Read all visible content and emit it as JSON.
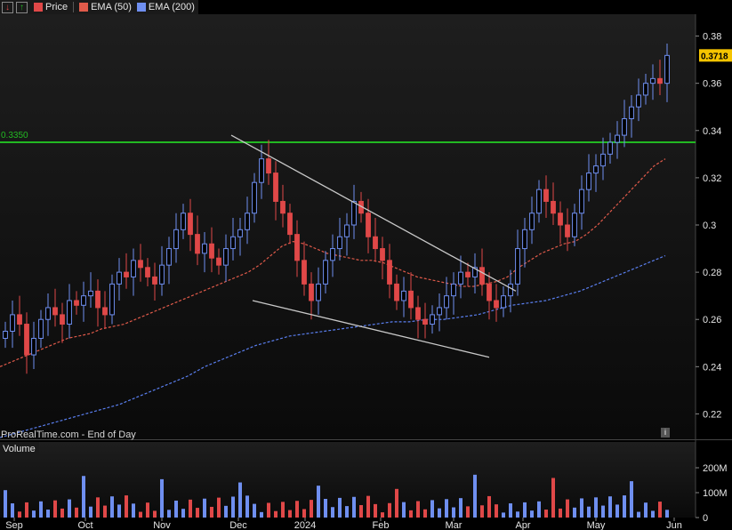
{
  "legend": {
    "price": "Price",
    "ema50": "EMA (50)",
    "ema200": "EMA (200)",
    "volume": "Volume",
    "colors": {
      "up": "#6f8ff0",
      "down": "#e04848",
      "ema50": "#e05a4a",
      "ema200": "#5a7ff0",
      "level": "#22b822"
    }
  },
  "watermark": "ProRealTime.com - End of Day",
  "info_icon": "i",
  "level_line": {
    "label": "0.3350",
    "value": 0.335
  },
  "last_price": "0.3718",
  "y_ticks": [
    "0.38",
    "0.36",
    "0.34",
    "0.32",
    "0.3",
    "0.28",
    "0.26",
    "0.24",
    "0.22"
  ],
  "volume_ticks": [
    "200M",
    "100M",
    "0"
  ],
  "x_ticks": [
    "Sep",
    "Oct",
    "Nov",
    "Dec",
    "2024",
    "Feb",
    "Mar",
    "Apr",
    "May",
    "Jun"
  ],
  "chart_data": {
    "type": "candlestick",
    "x_labels": [
      "Sep",
      "Oct",
      "Nov",
      "Dec",
      "2024",
      "Feb",
      "Mar",
      "Apr",
      "May",
      "Jun"
    ],
    "y_range": [
      0.21,
      0.39
    ],
    "volume_range_M": [
      0,
      250
    ],
    "horizontal_level": 0.335,
    "last_price": 0.3718,
    "close_series": [
      0.255,
      0.262,
      0.258,
      0.245,
      0.252,
      0.26,
      0.265,
      0.262,
      0.258,
      0.268,
      0.266,
      0.27,
      0.272,
      0.265,
      0.262,
      0.275,
      0.28,
      0.278,
      0.285,
      0.282,
      0.278,
      0.275,
      0.283,
      0.29,
      0.298,
      0.305,
      0.296,
      0.288,
      0.292,
      0.286,
      0.283,
      0.29,
      0.295,
      0.298,
      0.305,
      0.318,
      0.328,
      0.322,
      0.31,
      0.305,
      0.296,
      0.285,
      0.275,
      0.268,
      0.275,
      0.285,
      0.29,
      0.295,
      0.3,
      0.31,
      0.305,
      0.295,
      0.29,
      0.285,
      0.275,
      0.268,
      0.272,
      0.265,
      0.26,
      0.258,
      0.262,
      0.265,
      0.27,
      0.275,
      0.28,
      0.278,
      0.282,
      0.275,
      0.268,
      0.265,
      0.27,
      0.275,
      0.29,
      0.298,
      0.305,
      0.315,
      0.31,
      0.305,
      0.3,
      0.295,
      0.305,
      0.315,
      0.322,
      0.325,
      0.33,
      0.335,
      0.338,
      0.345,
      0.35,
      0.355,
      0.36,
      0.362,
      0.36,
      0.3718
    ],
    "ema50_series": [
      0.24,
      0.242,
      0.244,
      0.246,
      0.248,
      0.25,
      0.252,
      0.253,
      0.254,
      0.256,
      0.257,
      0.258,
      0.26,
      0.262,
      0.264,
      0.266,
      0.268,
      0.27,
      0.272,
      0.274,
      0.276,
      0.278,
      0.28,
      0.283,
      0.287,
      0.291,
      0.293,
      0.292,
      0.29,
      0.288,
      0.287,
      0.286,
      0.285,
      0.285,
      0.284,
      0.282,
      0.28,
      0.278,
      0.277,
      0.276,
      0.275,
      0.274,
      0.274,
      0.275,
      0.276,
      0.278,
      0.282,
      0.285,
      0.288,
      0.29,
      0.292,
      0.293,
      0.296,
      0.3,
      0.305,
      0.31,
      0.315,
      0.32,
      0.325,
      0.328
    ],
    "ema200_series": [
      0.21,
      0.212,
      0.214,
      0.216,
      0.218,
      0.22,
      0.222,
      0.224,
      0.227,
      0.23,
      0.233,
      0.236,
      0.24,
      0.243,
      0.246,
      0.249,
      0.251,
      0.253,
      0.254,
      0.255,
      0.256,
      0.257,
      0.258,
      0.259,
      0.259,
      0.26,
      0.26,
      0.261,
      0.262,
      0.264,
      0.266,
      0.267,
      0.268,
      0.27,
      0.272,
      0.275,
      0.278,
      0.281,
      0.284,
      0.287
    ],
    "trendline_upper": [
      [
        0.337,
        0
      ],
      [
        0.272,
        1
      ]
    ],
    "trendline_lower": [
      [
        0.268,
        0
      ],
      [
        0.244,
        1
      ]
    ]
  }
}
